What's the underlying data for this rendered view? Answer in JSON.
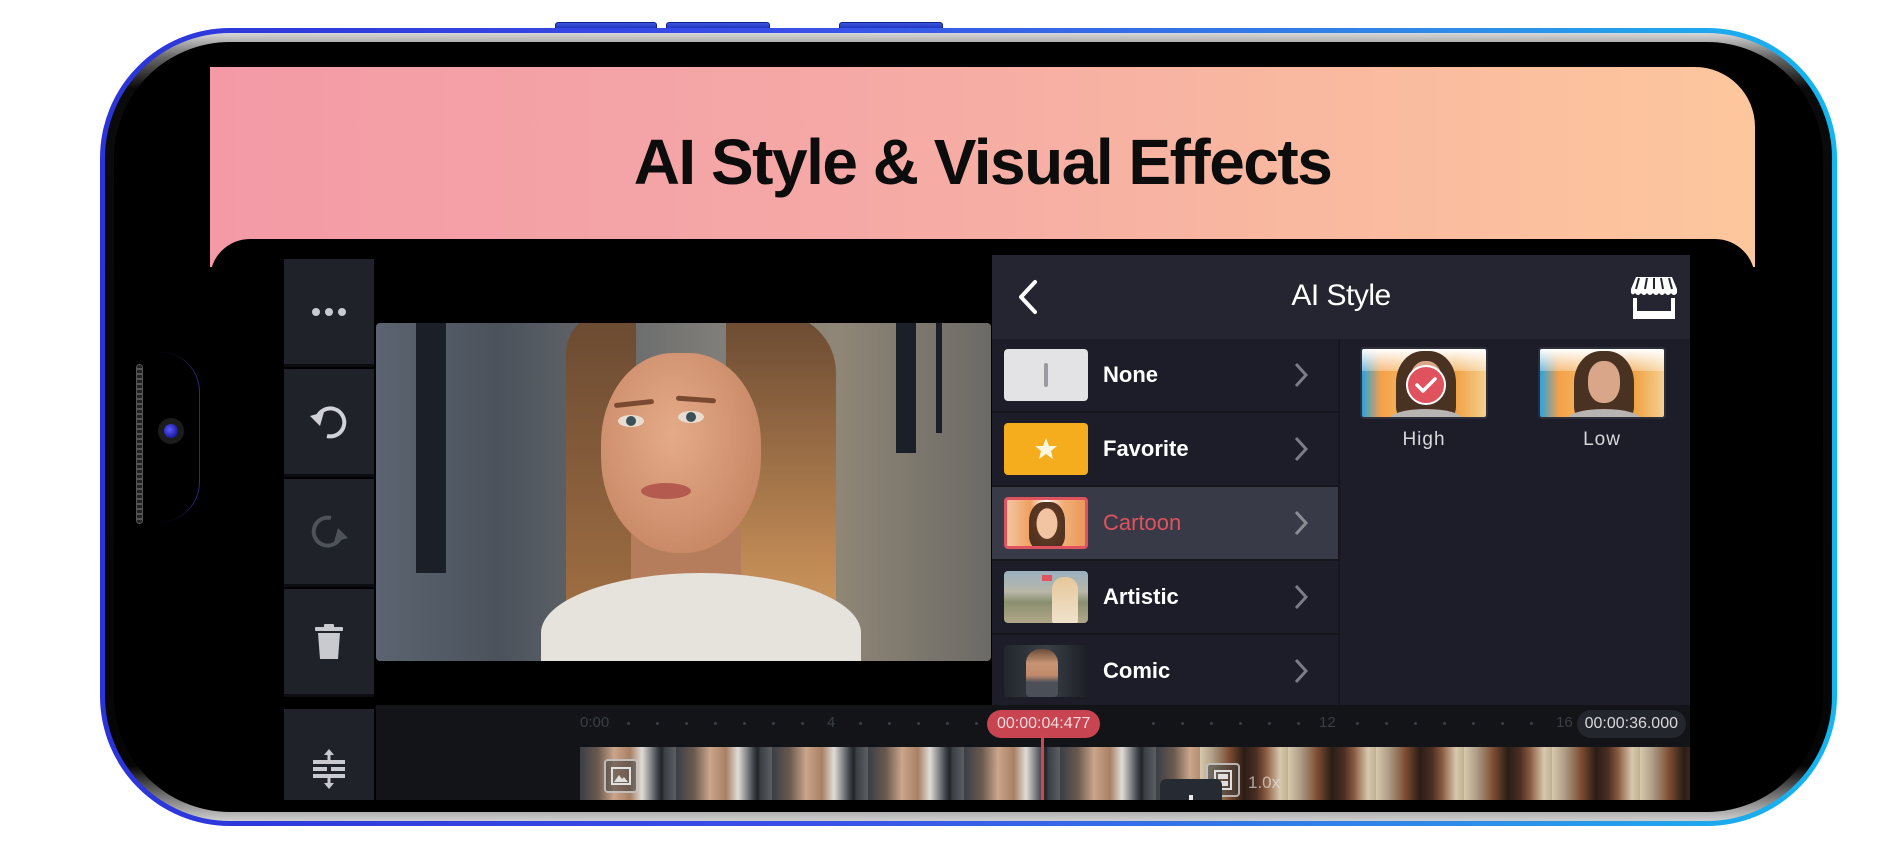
{
  "banner": {
    "title": "AI Style & Visual Effects",
    "gradient_start": "#f39aa6",
    "gradient_end": "#fdc79d"
  },
  "toolbar": {
    "items": [
      {
        "name": "more",
        "icon": "more-dots-icon",
        "enabled": true
      },
      {
        "name": "undo",
        "icon": "undo-icon",
        "enabled": true
      },
      {
        "name": "redo",
        "icon": "redo-icon",
        "enabled": false
      },
      {
        "name": "delete",
        "icon": "trash-icon",
        "enabled": true
      },
      {
        "name": "adjust_timeline",
        "icon": "expand-vertical-icon",
        "enabled": true
      }
    ]
  },
  "panel": {
    "title": "AI Style",
    "back_icon": "chevron-left-icon",
    "store_icon": "store-icon",
    "categories": [
      {
        "label": "None",
        "selected": false
      },
      {
        "label": "Favorite",
        "selected": false
      },
      {
        "label": "Cartoon",
        "selected": true
      },
      {
        "label": "Artistic",
        "selected": false
      },
      {
        "label": "Comic",
        "selected": false
      }
    ],
    "variants": [
      {
        "label": "High",
        "selected": true
      },
      {
        "label": "Low",
        "selected": false
      }
    ],
    "accent_color": "#e0525e"
  },
  "timeline": {
    "ticks": [
      "0:00",
      "4",
      "12",
      "16"
    ],
    "playhead_time": "00:00:04:477",
    "total_time": "00:00:36.000",
    "speed": "1.0x"
  }
}
